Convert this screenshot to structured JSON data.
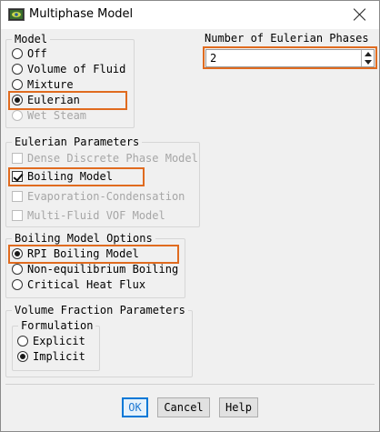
{
  "window": {
    "title": "Multiphase Model"
  },
  "model": {
    "label": "Model",
    "options": [
      {
        "label": "Off",
        "selected": false,
        "enabled": true
      },
      {
        "label": "Volume of Fluid",
        "selected": false,
        "enabled": true
      },
      {
        "label": "Mixture",
        "selected": false,
        "enabled": true
      },
      {
        "label": "Eulerian",
        "selected": true,
        "enabled": true
      },
      {
        "label": "Wet Steam",
        "selected": false,
        "enabled": false
      }
    ]
  },
  "phases": {
    "label": "Number of Eulerian Phases",
    "value": "2"
  },
  "eulerian_params": {
    "label": "Eulerian Parameters",
    "options": [
      {
        "label": "Dense Discrete Phase Model",
        "checked": false,
        "enabled": false
      },
      {
        "label": "Boiling Model",
        "checked": true,
        "enabled": true
      },
      {
        "label": "Evaporation-Condensation",
        "checked": false,
        "enabled": false
      },
      {
        "label": "Multi-Fluid VOF Model",
        "checked": false,
        "enabled": false
      }
    ]
  },
  "boiling": {
    "label": "Boiling Model Options",
    "options": [
      {
        "label": "RPI Boiling Model",
        "selected": true
      },
      {
        "label": "Non-equilibrium Boiling",
        "selected": false
      },
      {
        "label": "Critical Heat Flux",
        "selected": false
      }
    ]
  },
  "vf_params": {
    "label": "Volume Fraction Parameters",
    "formulation": {
      "label": "Formulation",
      "options": [
        {
          "label": "Explicit",
          "selected": false
        },
        {
          "label": "Implicit",
          "selected": true
        }
      ]
    }
  },
  "buttons": {
    "ok": "OK",
    "cancel": "Cancel",
    "help": "Help"
  },
  "colors": {
    "highlight": "#e06b1f",
    "accent": "#0078d7"
  }
}
